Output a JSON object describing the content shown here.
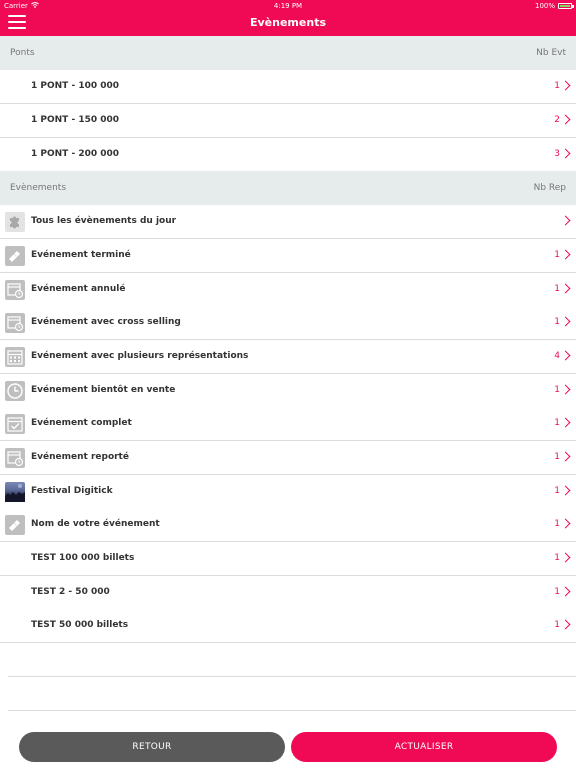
{
  "status": {
    "carrier": "Carrier",
    "time": "4:19 PM",
    "battery": "100%"
  },
  "header": {
    "title": "Evènements"
  },
  "ponts": {
    "header_left": "Ponts",
    "header_right": "Nb Evt",
    "items": [
      {
        "label": "1 PONT - 100 000",
        "count": "1"
      },
      {
        "label": "1 PONT - 150 000",
        "count": "2"
      },
      {
        "label": "1 PONT - 200 000",
        "count": "3"
      }
    ]
  },
  "events": {
    "header_left": "Evènements",
    "header_right": "Nb Rep",
    "items": [
      {
        "label": "Tous les évènements du jour",
        "count": "",
        "icon": "puzzle-icon"
      },
      {
        "label": "Evénement terminé",
        "count": "1",
        "icon": "ticket-icon"
      },
      {
        "label": "Evénement annulé",
        "count": "1",
        "icon": "calendar-clock-icon"
      },
      {
        "label": "Evénement avec cross selling",
        "count": "1",
        "icon": "calendar-clock-icon"
      },
      {
        "label": "Evénement avec plusieurs représentations",
        "count": "4",
        "icon": "calendar-icon"
      },
      {
        "label": "Evénement bientôt en vente",
        "count": "1",
        "icon": "clock-icon"
      },
      {
        "label": "Evénement complet",
        "count": "1",
        "icon": "calendar-check-icon"
      },
      {
        "label": "Evénement reporté",
        "count": "1",
        "icon": "calendar-clock-icon"
      },
      {
        "label": "Festival Digitick",
        "count": "1",
        "icon": "festival-photo-icon"
      },
      {
        "label": "Nom de votre événement",
        "count": "1",
        "icon": "ticket-icon"
      },
      {
        "label": "TEST 100 000 billets",
        "count": "1",
        "icon": ""
      },
      {
        "label": "TEST 2 - 50 000",
        "count": "1",
        "icon": ""
      },
      {
        "label": "TEST 50 000 billets",
        "count": "1",
        "icon": ""
      }
    ]
  },
  "buttons": {
    "back": "RETOUR",
    "refresh": "ACTUALISER"
  },
  "colors": {
    "accent": "#f00a55",
    "secondary": "#5a5a5a",
    "section_bg": "#e6ebec"
  }
}
